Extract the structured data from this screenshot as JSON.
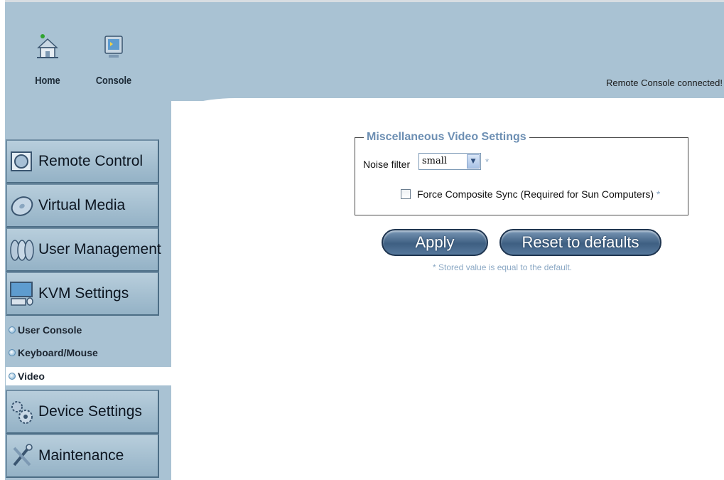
{
  "header": {
    "home_label": "Home",
    "console_label": "Console",
    "status_text": "Remote Console connected!"
  },
  "sidebar": {
    "items": [
      {
        "label": "Remote Control",
        "icon": "remote-control-icon"
      },
      {
        "label": "Virtual Media",
        "icon": "disc-icon"
      },
      {
        "label": "User Management",
        "icon": "users-icon"
      },
      {
        "label": "KVM Settings",
        "icon": "monitor-icon"
      },
      {
        "label": "Device Settings",
        "icon": "gears-icon"
      },
      {
        "label": "Maintenance",
        "icon": "tools-icon"
      }
    ],
    "subitems": [
      {
        "label": "User Console"
      },
      {
        "label": "Keyboard/Mouse"
      },
      {
        "label": "Video",
        "active": true
      }
    ]
  },
  "form": {
    "legend": "Miscellaneous Video Settings",
    "noise_label": "Noise filter",
    "noise_value": "small",
    "asterisk": "*",
    "composite_label": "Force Composite Sync (Required for Sun Computers)",
    "composite_checked": false
  },
  "buttons": {
    "apply_label": "Apply",
    "reset_label": "Reset to defaults"
  },
  "hint": "* Stored value is equal to the default.",
  "colors": {
    "band": "#a9c2d3",
    "legend": "#6d8fb3",
    "button": "#3e5f82"
  }
}
